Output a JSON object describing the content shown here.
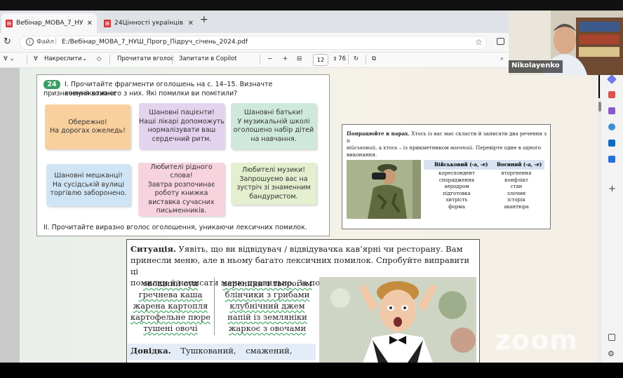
{
  "browser": {
    "tabs": [
      {
        "label": "Вебінар_МОВА_7_НУШ_Прогр_",
        "active": true
      },
      {
        "label": "24Цінності українців.pdf",
        "active": false
      }
    ],
    "file_label": "Файл",
    "url": "E:/Вебінар_МОВА_7_НУШ_Прогр_Підруч_січень_2024.pdf"
  },
  "pdf_toolbar": {
    "draw_label": "Накреслити",
    "read_aloud_label": "Прочитати вголос",
    "ask_copilot_label": "Запитати в Copilot",
    "zoom_out": "−",
    "zoom_in": "+",
    "page_current": "12",
    "page_total": "з 76"
  },
  "exercise24": {
    "number": "24",
    "task1_line1": "І. Прочитайте фрагменти оголошень на с. 14–15. Визначте комунікативне",
    "task1_line2": "призначення кожного з них. Які помилки ви помітили?",
    "cards": [
      {
        "text": "Обережно!\nНа дорогах ожеледь!",
        "color": "#f9cf9e"
      },
      {
        "text": "Шановні пацієнти!\nНаші лікарі допоможуть\nнормалізувати ваш\nсердечний ритм.",
        "color": "#e3d3ee"
      },
      {
        "text": "Шановні батьки!\nУ музикальній школі\nоголошено набір дітей\nна навчання.",
        "color": "#cfe8dc"
      },
      {
        "text": "Шановні мешканці!\nНа сусідській вулиці\nторгівлю заборонено.",
        "color": "#cfe5f5"
      },
      {
        "text": "Любителі рідного слова!\nЗавтра розпочинає\nроботу книжка\nвиставка сучасних\nписьменників.",
        "color": "#f7d3de"
      },
      {
        "text": "Любителі музики!\nЗапрошуємо вас на\nзустріч зі знаменним\nбандуристом.",
        "color": "#e3efcf"
      }
    ],
    "task2": "ІІ. Прочитайте виразно вголос оголошення, уникаючи лексичних помилок."
  },
  "pair_task": {
    "bold": "Попрацюйте в парах.",
    "line1_rest": " Хтось із вас має скласти й записати два речення з п",
    "line2_a": "військовий",
    "line2_b": ", а хтось – із прикметником ",
    "line2_c": "воєнний",
    "line2_d": ". Перевірте одне в одного",
    "line3": "виконання.",
    "col1_head": "Військовий (-а, -е)",
    "col2_head": "Воєнний (-а, -е)",
    "col1": [
      "кореспондент",
      "спорядження",
      "аеродром",
      "підготовка",
      "хитрість",
      "форма"
    ],
    "col2": [
      "вторгнення",
      "конфлікт",
      "стан",
      "злочин",
      "історія",
      "авантюра"
    ]
  },
  "situation": {
    "bold": "Ситуація.",
    "line1_rest": " Уявіть, що ви відвідувач / відвідувачка кав’ярні чи ресторану. Вам",
    "line2": "принесли меню, але в ньому багато лексичних помилок. Спробуйте виправити ці",
    "line3": "помилки й написати меню правильно. За потреби скористайтеся довідкою.",
    "menu_left": [
      "овощний суп",
      "гречнева каша",
      "жарена картопля",
      "картофельне пюре",
      "тушені овочі"
    ],
    "menu_right": [
      "вареники з творогом",
      "блінчики з грибами",
      "клубнічний джем",
      "напій із земляніки",
      "жаркоє з овочами"
    ],
    "dovidka_bold": "Довідка.",
    "dovidka_rest": " Тушкований, смажений,"
  },
  "video": {
    "participant_name": "Nikolayenko"
  },
  "zoom_watermark": "zoom",
  "colors": {
    "accent_green": "#3a9c64",
    "pdf_red": "#d13438"
  }
}
